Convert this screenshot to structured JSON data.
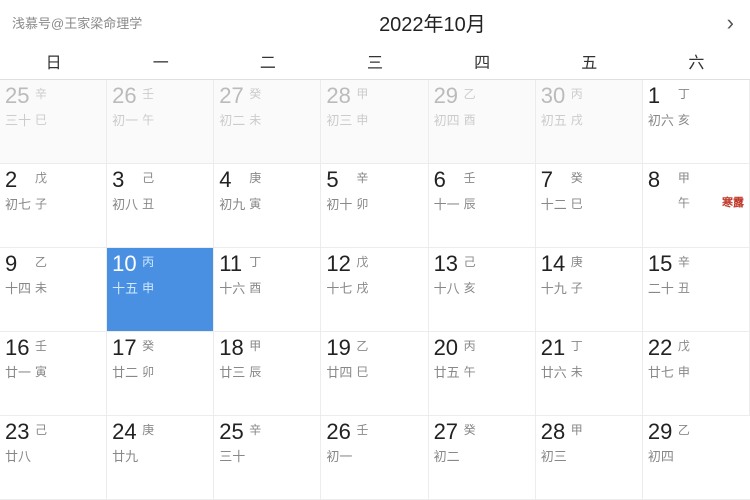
{
  "header": {
    "watermark": "浅慕号@王家梁命理学",
    "title": "2022年10月",
    "nav_next": "›"
  },
  "weekdays": [
    "日",
    "一",
    "二",
    "三",
    "四",
    "五",
    "六"
  ],
  "days": [
    {
      "date": 25,
      "gz_top": "辛",
      "lunar": "三十",
      "gz_bot": "巳",
      "other": true,
      "term": ""
    },
    {
      "date": 26,
      "gz_top": "壬",
      "lunar": "初一",
      "gz_bot": "午",
      "other": true,
      "term": ""
    },
    {
      "date": 27,
      "gz_top": "癸",
      "lunar": "初二",
      "gz_bot": "未",
      "other": true,
      "term": ""
    },
    {
      "date": 28,
      "gz_top": "甲",
      "lunar": "初三",
      "gz_bot": "申",
      "other": true,
      "term": ""
    },
    {
      "date": 29,
      "gz_top": "乙",
      "lunar": "初四",
      "gz_bot": "酉",
      "other": true,
      "term": ""
    },
    {
      "date": 30,
      "gz_top": "丙",
      "lunar": "初五",
      "gz_bot": "戌",
      "other": true,
      "term": ""
    },
    {
      "date": 1,
      "gz_top": "丁",
      "lunar": "初六",
      "gz_bot": "亥",
      "other": false,
      "term": ""
    },
    {
      "date": 2,
      "gz_top": "戊",
      "lunar": "初七",
      "gz_bot": "子",
      "other": false,
      "term": ""
    },
    {
      "date": 3,
      "gz_top": "己",
      "lunar": "初八",
      "gz_bot": "丑",
      "other": false,
      "term": ""
    },
    {
      "date": 4,
      "gz_top": "庚",
      "lunar": "初九",
      "gz_bot": "寅",
      "other": false,
      "term": ""
    },
    {
      "date": 5,
      "gz_top": "辛",
      "lunar": "初十",
      "gz_bot": "卯",
      "other": false,
      "term": ""
    },
    {
      "date": 6,
      "gz_top": "壬",
      "lunar": "十一",
      "gz_bot": "辰",
      "other": false,
      "term": ""
    },
    {
      "date": 7,
      "gz_top": "癸",
      "lunar": "十二",
      "gz_bot": "巳",
      "other": false,
      "term": ""
    },
    {
      "date": 8,
      "gz_top": "甲",
      "lunar": "寒露",
      "gz_bot": "午",
      "other": false,
      "term": "寒露"
    },
    {
      "date": 9,
      "gz_top": "乙",
      "lunar": "十四",
      "gz_bot": "未",
      "other": false,
      "term": ""
    },
    {
      "date": 10,
      "gz_top": "丙",
      "lunar": "十五",
      "gz_bot": "申",
      "other": false,
      "today": true,
      "term": ""
    },
    {
      "date": 11,
      "gz_top": "丁",
      "lunar": "十六",
      "gz_bot": "酉",
      "other": false,
      "term": ""
    },
    {
      "date": 12,
      "gz_top": "戊",
      "lunar": "十七",
      "gz_bot": "戌",
      "other": false,
      "term": ""
    },
    {
      "date": 13,
      "gz_top": "己",
      "lunar": "十八",
      "gz_bot": "亥",
      "other": false,
      "term": ""
    },
    {
      "date": 14,
      "gz_top": "庚",
      "lunar": "十九",
      "gz_bot": "子",
      "other": false,
      "term": ""
    },
    {
      "date": 15,
      "gz_top": "辛",
      "lunar": "二十",
      "gz_bot": "丑",
      "other": false,
      "term": ""
    },
    {
      "date": 16,
      "gz_top": "壬",
      "lunar": "廿一",
      "gz_bot": "寅",
      "other": false,
      "term": ""
    },
    {
      "date": 17,
      "gz_top": "癸",
      "lunar": "廿二",
      "gz_bot": "卯",
      "other": false,
      "term": ""
    },
    {
      "date": 18,
      "gz_top": "甲",
      "lunar": "廿三",
      "gz_bot": "辰",
      "other": false,
      "term": ""
    },
    {
      "date": 19,
      "gz_top": "乙",
      "lunar": "廿四",
      "gz_bot": "巳",
      "other": false,
      "term": ""
    },
    {
      "date": 20,
      "gz_top": "丙",
      "lunar": "廿五",
      "gz_bot": "午",
      "other": false,
      "term": ""
    },
    {
      "date": 21,
      "gz_top": "丁",
      "lunar": "廿六",
      "gz_bot": "未",
      "other": false,
      "term": ""
    },
    {
      "date": 22,
      "gz_top": "戊",
      "lunar": "廿七",
      "gz_bot": "申",
      "other": false,
      "term": ""
    },
    {
      "date": 23,
      "gz_top": "己",
      "lunar": "廿八",
      "gz_bot": "",
      "other": false,
      "term": ""
    },
    {
      "date": 24,
      "gz_top": "庚",
      "lunar": "廿九",
      "gz_bot": "",
      "other": false,
      "term": ""
    },
    {
      "date": 25,
      "gz_top": "辛",
      "lunar": "三十",
      "gz_bot": "",
      "other": false,
      "term": ""
    },
    {
      "date": 26,
      "gz_top": "壬",
      "lunar": "初一",
      "gz_bot": "",
      "other": false,
      "term": ""
    },
    {
      "date": 27,
      "gz_top": "癸",
      "lunar": "初二",
      "gz_bot": "",
      "other": false,
      "term": ""
    },
    {
      "date": 28,
      "gz_top": "甲",
      "lunar": "初三",
      "gz_bot": "",
      "other": false,
      "term": ""
    },
    {
      "date": 29,
      "gz_top": "乙",
      "lunar": "初四",
      "gz_bot": "",
      "other": false,
      "term": ""
    }
  ]
}
